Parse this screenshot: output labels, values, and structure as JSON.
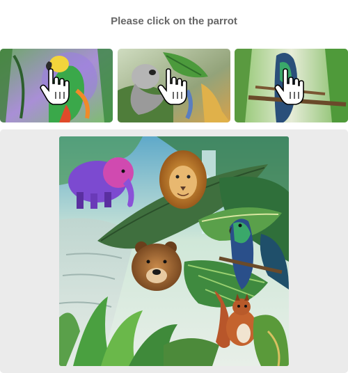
{
  "prompt": {
    "text": "Please click on the parrot"
  },
  "examples": [
    {
      "subject": "parrot",
      "icon": "hand-cursor-icon"
    },
    {
      "subject": "parrot",
      "icon": "hand-cursor-icon"
    },
    {
      "subject": "parrot",
      "icon": "hand-cursor-icon"
    }
  ],
  "scene": {
    "animals": [
      "elephant",
      "lion",
      "bear",
      "parrot",
      "squirrel"
    ]
  },
  "colors": {
    "prompt_text": "#666666",
    "stage_bg": "#ebebeb",
    "page_bg": "#ffffff"
  }
}
